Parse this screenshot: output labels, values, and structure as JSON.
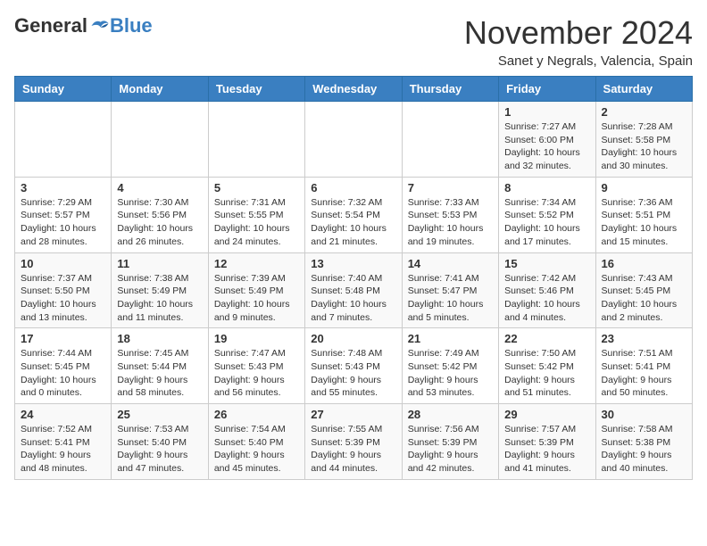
{
  "header": {
    "logo": {
      "general": "General",
      "blue": "Blue"
    },
    "title": "November 2024",
    "subtitle": "Sanet y Negrals, Valencia, Spain"
  },
  "weekdays": [
    "Sunday",
    "Monday",
    "Tuesday",
    "Wednesday",
    "Thursday",
    "Friday",
    "Saturday"
  ],
  "weeks": [
    [
      {
        "day": "",
        "info": ""
      },
      {
        "day": "",
        "info": ""
      },
      {
        "day": "",
        "info": ""
      },
      {
        "day": "",
        "info": ""
      },
      {
        "day": "",
        "info": ""
      },
      {
        "day": "1",
        "info": "Sunrise: 7:27 AM\nSunset: 6:00 PM\nDaylight: 10 hours\nand 32 minutes."
      },
      {
        "day": "2",
        "info": "Sunrise: 7:28 AM\nSunset: 5:58 PM\nDaylight: 10 hours\nand 30 minutes."
      }
    ],
    [
      {
        "day": "3",
        "info": "Sunrise: 7:29 AM\nSunset: 5:57 PM\nDaylight: 10 hours\nand 28 minutes."
      },
      {
        "day": "4",
        "info": "Sunrise: 7:30 AM\nSunset: 5:56 PM\nDaylight: 10 hours\nand 26 minutes."
      },
      {
        "day": "5",
        "info": "Sunrise: 7:31 AM\nSunset: 5:55 PM\nDaylight: 10 hours\nand 24 minutes."
      },
      {
        "day": "6",
        "info": "Sunrise: 7:32 AM\nSunset: 5:54 PM\nDaylight: 10 hours\nand 21 minutes."
      },
      {
        "day": "7",
        "info": "Sunrise: 7:33 AM\nSunset: 5:53 PM\nDaylight: 10 hours\nand 19 minutes."
      },
      {
        "day": "8",
        "info": "Sunrise: 7:34 AM\nSunset: 5:52 PM\nDaylight: 10 hours\nand 17 minutes."
      },
      {
        "day": "9",
        "info": "Sunrise: 7:36 AM\nSunset: 5:51 PM\nDaylight: 10 hours\nand 15 minutes."
      }
    ],
    [
      {
        "day": "10",
        "info": "Sunrise: 7:37 AM\nSunset: 5:50 PM\nDaylight: 10 hours\nand 13 minutes."
      },
      {
        "day": "11",
        "info": "Sunrise: 7:38 AM\nSunset: 5:49 PM\nDaylight: 10 hours\nand 11 minutes."
      },
      {
        "day": "12",
        "info": "Sunrise: 7:39 AM\nSunset: 5:49 PM\nDaylight: 10 hours\nand 9 minutes."
      },
      {
        "day": "13",
        "info": "Sunrise: 7:40 AM\nSunset: 5:48 PM\nDaylight: 10 hours\nand 7 minutes."
      },
      {
        "day": "14",
        "info": "Sunrise: 7:41 AM\nSunset: 5:47 PM\nDaylight: 10 hours\nand 5 minutes."
      },
      {
        "day": "15",
        "info": "Sunrise: 7:42 AM\nSunset: 5:46 PM\nDaylight: 10 hours\nand 4 minutes."
      },
      {
        "day": "16",
        "info": "Sunrise: 7:43 AM\nSunset: 5:45 PM\nDaylight: 10 hours\nand 2 minutes."
      }
    ],
    [
      {
        "day": "17",
        "info": "Sunrise: 7:44 AM\nSunset: 5:45 PM\nDaylight: 10 hours\nand 0 minutes."
      },
      {
        "day": "18",
        "info": "Sunrise: 7:45 AM\nSunset: 5:44 PM\nDaylight: 9 hours\nand 58 minutes."
      },
      {
        "day": "19",
        "info": "Sunrise: 7:47 AM\nSunset: 5:43 PM\nDaylight: 9 hours\nand 56 minutes."
      },
      {
        "day": "20",
        "info": "Sunrise: 7:48 AM\nSunset: 5:43 PM\nDaylight: 9 hours\nand 55 minutes."
      },
      {
        "day": "21",
        "info": "Sunrise: 7:49 AM\nSunset: 5:42 PM\nDaylight: 9 hours\nand 53 minutes."
      },
      {
        "day": "22",
        "info": "Sunrise: 7:50 AM\nSunset: 5:42 PM\nDaylight: 9 hours\nand 51 minutes."
      },
      {
        "day": "23",
        "info": "Sunrise: 7:51 AM\nSunset: 5:41 PM\nDaylight: 9 hours\nand 50 minutes."
      }
    ],
    [
      {
        "day": "24",
        "info": "Sunrise: 7:52 AM\nSunset: 5:41 PM\nDaylight: 9 hours\nand 48 minutes."
      },
      {
        "day": "25",
        "info": "Sunrise: 7:53 AM\nSunset: 5:40 PM\nDaylight: 9 hours\nand 47 minutes."
      },
      {
        "day": "26",
        "info": "Sunrise: 7:54 AM\nSunset: 5:40 PM\nDaylight: 9 hours\nand 45 minutes."
      },
      {
        "day": "27",
        "info": "Sunrise: 7:55 AM\nSunset: 5:39 PM\nDaylight: 9 hours\nand 44 minutes."
      },
      {
        "day": "28",
        "info": "Sunrise: 7:56 AM\nSunset: 5:39 PM\nDaylight: 9 hours\nand 42 minutes."
      },
      {
        "day": "29",
        "info": "Sunrise: 7:57 AM\nSunset: 5:39 PM\nDaylight: 9 hours\nand 41 minutes."
      },
      {
        "day": "30",
        "info": "Sunrise: 7:58 AM\nSunset: 5:38 PM\nDaylight: 9 hours\nand 40 minutes."
      }
    ]
  ]
}
